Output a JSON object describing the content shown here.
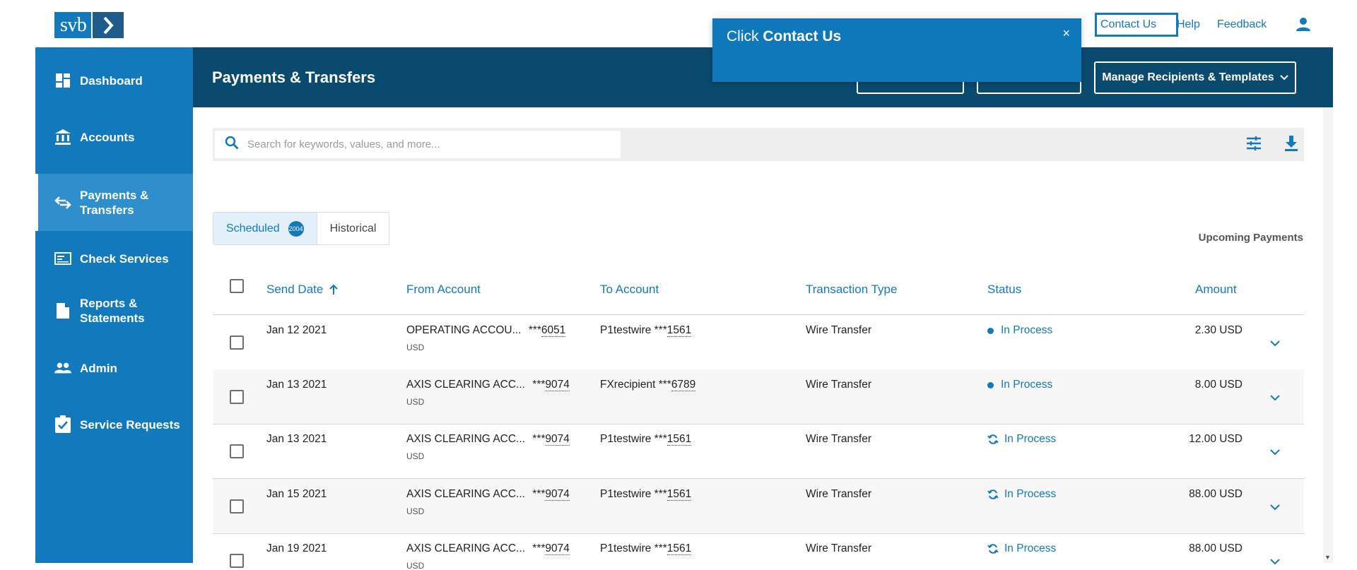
{
  "brand": {
    "logo_text": "svb"
  },
  "topnav": {
    "contact": "Contact Us",
    "help": "Help",
    "feedback": "Feedback"
  },
  "tooltip": {
    "prefix": "Click ",
    "target": "Contact Us",
    "close": "×"
  },
  "sidebar": {
    "items": [
      {
        "label": "Dashboard",
        "icon": "dashboard-icon"
      },
      {
        "label": "Accounts",
        "icon": "bank-icon"
      },
      {
        "label": "Payments & Transfers",
        "icon": "transfer-arrows-icon",
        "active": true
      },
      {
        "label": "Check Services",
        "icon": "check-card-icon"
      },
      {
        "label": "Reports & Statements",
        "icon": "document-icon"
      },
      {
        "label": "Admin",
        "icon": "people-icon"
      },
      {
        "label": "Service Requests",
        "icon": "clipboard-check-icon"
      }
    ]
  },
  "header": {
    "title": "Payments & Transfers",
    "manage_button": "Manage Recipients & Templates"
  },
  "search": {
    "placeholder": "Search for keywords, values, and more..."
  },
  "tabs": {
    "scheduled": "Scheduled",
    "scheduled_count": "2004",
    "historical": "Historical"
  },
  "upcoming_label": "Upcoming Payments",
  "table": {
    "headers": {
      "send_date": "Send Date",
      "from": "From Account",
      "to": "To Account",
      "type": "Transaction Type",
      "status": "Status",
      "amount": "Amount"
    },
    "rows": [
      {
        "date": "Jan 12 2021",
        "from_name": "OPERATING ACCOU...",
        "from_mask": "***",
        "from_num": "6051",
        "currency": "USD",
        "to_name": "P1testwire ",
        "to_mask": "***",
        "to_num": "1561",
        "type": "Wire Transfer",
        "status": "In Process",
        "status_icon": "dot",
        "amount": "2.30 USD"
      },
      {
        "date": "Jan 13 2021",
        "from_name": "AXIS CLEARING ACC...",
        "from_mask": "***",
        "from_num": "9074",
        "currency": "USD",
        "to_name": "FXrecipient ",
        "to_mask": "***",
        "to_num": "6789",
        "type": "Wire Transfer",
        "status": "In Process",
        "status_icon": "dot",
        "amount": "8.00 USD"
      },
      {
        "date": "Jan 13 2021",
        "from_name": "AXIS CLEARING ACC...",
        "from_mask": "***",
        "from_num": "9074",
        "currency": "USD",
        "to_name": "P1testwire ",
        "to_mask": "***",
        "to_num": "1561",
        "type": "Wire Transfer",
        "status": "In Process",
        "status_icon": "refresh",
        "amount": "12.00 USD"
      },
      {
        "date": "Jan 15 2021",
        "from_name": "AXIS CLEARING ACC...",
        "from_mask": "***",
        "from_num": "9074",
        "currency": "USD",
        "to_name": "P1testwire ",
        "to_mask": "***",
        "to_num": "1561",
        "type": "Wire Transfer",
        "status": "In Process",
        "status_icon": "refresh",
        "amount": "88.00 USD"
      },
      {
        "date": "Jan 19 2021",
        "from_name": "AXIS CLEARING ACC...",
        "from_mask": "***",
        "from_num": "9074",
        "currency": "USD",
        "to_name": "P1testwire ",
        "to_mask": "***",
        "to_num": "1561",
        "type": "Wire Transfer",
        "status": "In Process",
        "status_icon": "refresh",
        "amount": "88.00 USD"
      }
    ]
  },
  "colors": {
    "brand_blue": "#1379bd",
    "header_navy": "#0b4a6f",
    "tooltip_blue": "#0f78ba"
  }
}
